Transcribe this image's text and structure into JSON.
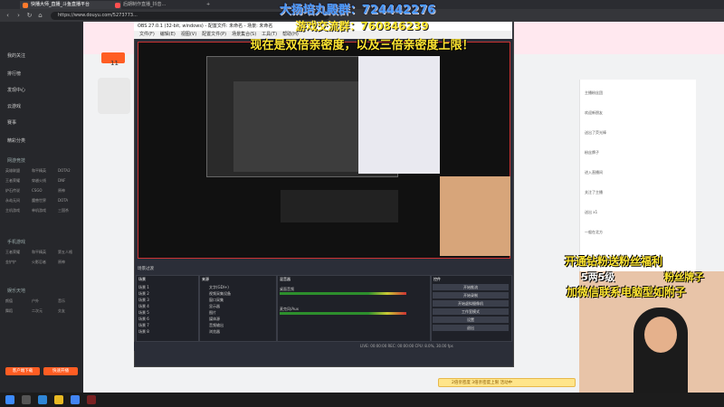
{
  "browser": {
    "tabs": [
      "快播大师_直播_斗鱼直播平台",
      "后期制作直播_抖音..."
    ],
    "url": "https://www.douyu.com/5273773..."
  },
  "overlay": {
    "line1": "大扬培丸殿群：724442276",
    "line2": "游戏交流群：760846239",
    "line3": "现在是双倍亲密度，以及三倍亲密度上限！",
    "promo1": "开通钻粉送粉丝福利",
    "promo2": "5两5级",
    "promo3": "粉丝牌子",
    "promo4": "加微信联系电脑型如附子"
  },
  "sidebar": {
    "items": [
      "我的关注",
      "排行榜",
      "发现中心",
      "云游戏",
      "赛事",
      "精彩分类"
    ],
    "section1": "网游竞技",
    "grid1": [
      "英雄联盟",
      "和平精英",
      "DOTA2",
      "王者荣耀",
      "穿越火线",
      "DNF",
      "炉石传说",
      "CSGO",
      "原神",
      "永劫无间",
      "魔兽世界",
      "DOTA",
      "主机游戏",
      "单机游戏",
      "三国杀"
    ],
    "section2": "手机游戏",
    "grid2": [
      "王者荣耀",
      "和平精英",
      "第五人格",
      "金铲铲",
      "火影忍者",
      "原神"
    ],
    "section3": "娱乐天地",
    "grid3": [
      "颜值",
      "户外",
      "音乐",
      "舞蹈",
      "二次元",
      "交友"
    ],
    "buttons": [
      "客户端下载",
      "快速开播"
    ]
  },
  "obs": {
    "title": "OBS 27.0.1 (32-bit, windows) - 配置文件: 未命名 - 场景: 未命名",
    "menu": [
      "文件(F)",
      "编辑(E)",
      "视图(V)",
      "配置文件(P)",
      "场景集合(S)",
      "工具(T)",
      "帮助(H)"
    ],
    "scenes_head": "场景",
    "scenes": [
      "场景 1",
      "场景 2",
      "场景 3",
      "场景 4",
      "场景 5",
      "场景 6",
      "场景 7",
      "场景 8"
    ],
    "sources_head": "来源",
    "sources": [
      "文字(GDI+)",
      "视频采集设备",
      "窗口采集",
      "显示器",
      "图片",
      "媒体源",
      "音频输出",
      "浏览器"
    ],
    "mixer_head": "混音器",
    "mixer": [
      "桌面音频",
      "麦克风/Aux"
    ],
    "controls_head": "控件",
    "controls": [
      "开始推流",
      "开始录制",
      "开始虚拟摄像机",
      "工作室模式",
      "设置",
      "退出"
    ],
    "status": "LIVE: 00:00:00   REC: 00:00:00   CPU: 8.0%, 30.00 fps"
  },
  "page": {
    "room_num": "11",
    "toast": "2倍亲密度 3倍亲密度上限 活动中"
  },
  "chat": [
    "主播粉丝团",
    "欢迎新朋友",
    "送出了荧光棒",
    "粉丝牌子",
    "进入直播间",
    "关注了主播",
    "送出 x1",
    "一般在北方"
  ],
  "colors": {
    "accent": "#ff5d23",
    "overlay_yellow": "#ffe632",
    "overlay_blue": "#4d9dff"
  }
}
